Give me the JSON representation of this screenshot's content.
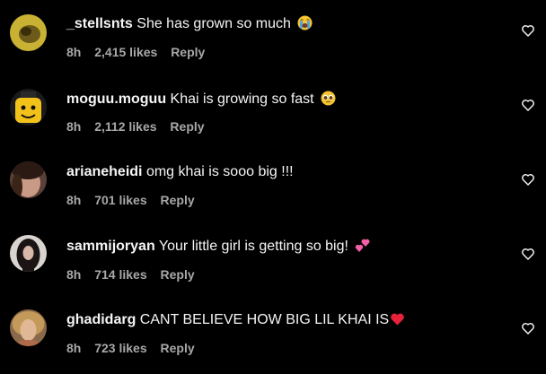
{
  "comments": [
    {
      "username": "_stellsnts",
      "text": "She has grown so much",
      "emoji": "loudly-crying-face-emoji",
      "time": "8h",
      "likes": "2,415 likes",
      "reply": "Reply",
      "avatar_icon": "yellow-blob-avatar"
    },
    {
      "username": "moguu.moguu",
      "text": "Khai is growing so fast",
      "emoji": "pleading-face-emoji",
      "time": "8h",
      "likes": "2,112 likes",
      "reply": "Reply",
      "avatar_icon": "lego-head-avatar"
    },
    {
      "username": "arianeheidi",
      "text": "omg khai is sooo big !!!",
      "time": "8h",
      "likes": "701 likes",
      "reply": "Reply",
      "avatar_icon": "photo-avatar"
    },
    {
      "username": "sammijoryan",
      "text": "Your little girl is getting so big!",
      "emoji": "two-hearts-emoji",
      "time": "8h",
      "likes": "714 likes",
      "reply": "Reply",
      "avatar_icon": "photo-avatar"
    },
    {
      "username": "ghadidarg",
      "text": "CANT BELIEVE HOW BIG LIL KHAI IS",
      "emoji": "red-heart-emoji",
      "time": "8h",
      "likes": "723 likes",
      "reply": "Reply",
      "avatar_icon": "photo-avatar"
    }
  ],
  "like_icon": "heart-outline-icon",
  "colors": {
    "background": "#000000",
    "text": "#f5f5f5",
    "meta": "#a8a8a8"
  }
}
